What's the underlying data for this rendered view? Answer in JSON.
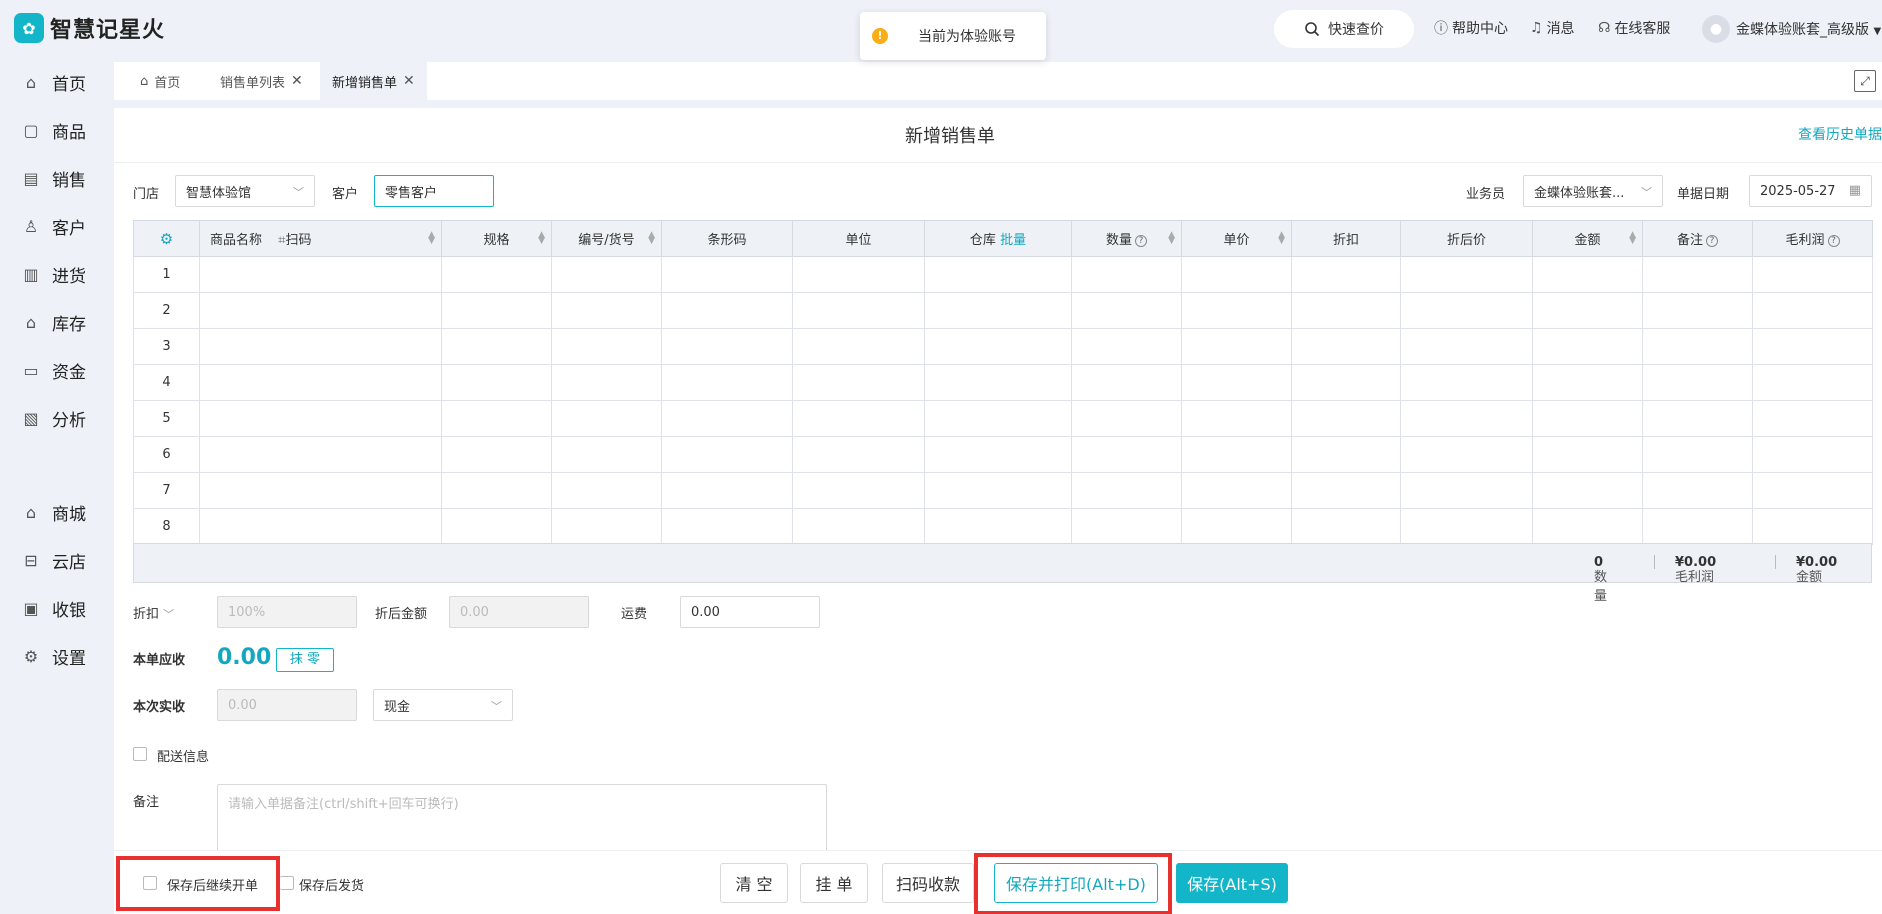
{
  "app": {
    "name": "智慧记星火",
    "logo_glyph": "✿"
  },
  "toast": {
    "icon": "!",
    "text": "当前为体验账号"
  },
  "header": {
    "quick_price": "快速查价",
    "help": "帮助中心",
    "messages": "消息",
    "support": "在线客服",
    "account": "金蝶体验账套_高级版"
  },
  "sidebar": {
    "items": [
      {
        "label": "首页",
        "icon": "⌂"
      },
      {
        "label": "商品",
        "icon": "▢"
      },
      {
        "label": "销售",
        "icon": "▤"
      },
      {
        "label": "客户",
        "icon": "♙"
      },
      {
        "label": "进货",
        "icon": "▥"
      },
      {
        "label": "库存",
        "icon": "⌂"
      },
      {
        "label": "资金",
        "icon": "▭"
      },
      {
        "label": "分析",
        "icon": "▧"
      },
      {
        "label": "商城",
        "icon": "⌂"
      },
      {
        "label": "云店",
        "icon": "⊟"
      },
      {
        "label": "收银",
        "icon": "▣"
      },
      {
        "label": "设置",
        "icon": "⚙"
      }
    ]
  },
  "tabs": [
    {
      "label": "首页"
    },
    {
      "label": "销售单列表"
    },
    {
      "label": "新增销售单"
    }
  ],
  "form": {
    "title": "新增销售单",
    "history_link": "查看历史单据",
    "store_label": "门店",
    "store_value": "智慧体验馆",
    "customer_label": "客户",
    "customer_value": "零售客户",
    "salesperson_label": "业务员",
    "salesperson_value": "金蝶体验账套...",
    "date_label": "单据日期",
    "date_value": "2025-05-27"
  },
  "table": {
    "columns": {
      "name": "商品名称",
      "scan": "扫码",
      "spec": "规格",
      "code": "编号/货号",
      "barcode": "条形码",
      "unit": "单位",
      "warehouse": "仓库",
      "batch": "批量",
      "qty": "数量",
      "price": "单价",
      "discount": "折扣",
      "disc_price": "折后价",
      "amount": "金额",
      "remark": "备注",
      "profit": "毛利润"
    },
    "rows": [
      "1",
      "2",
      "3",
      "4",
      "5",
      "6",
      "7",
      "8"
    ]
  },
  "summary": {
    "qty_label": "数量",
    "qty_value": "0",
    "profit_label": "毛利润",
    "profit_value": "¥0.00",
    "amount_label": "金额",
    "amount_value": "¥0.00"
  },
  "payment": {
    "discount_label": "折扣",
    "discount_value": "100%",
    "disc_amount_label": "折后金额",
    "disc_amount_value": "0.00",
    "freight_label": "运费",
    "freight_value": "0.00",
    "receivable_label": "本单应收",
    "receivable_value": "0.00",
    "round_label": "抹 零",
    "received_label": "本次实收",
    "received_value": "0.00",
    "method_value": "现金",
    "delivery_label": "配送信息",
    "remark_label": "备注",
    "remark_placeholder": "请输入单据备注(ctrl/shift+回车可换行)"
  },
  "footer": {
    "continue_label": "保存后继续开单",
    "ship_label": "保存后发货",
    "clear": "清 空",
    "hold": "挂 单",
    "scan_pay": "扫码收款",
    "save_print": "保存并打印(Alt+D)",
    "save": "保存(Alt+S)"
  },
  "colors": {
    "accent": "#13b5c9",
    "highlight": "#e8312f",
    "warning": "#faad14"
  }
}
